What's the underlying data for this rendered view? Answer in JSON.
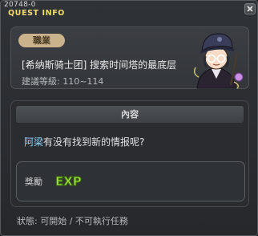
{
  "window": {
    "quest_id": "20748-0",
    "title": "QUEST INFO"
  },
  "job": {
    "tag": "職業",
    "name": "[希纳斯骑士团] 搜索时间塔的最底层",
    "level": "建議等級: 110~114"
  },
  "content": {
    "header": "內容",
    "npc_name": "阿梁",
    "text": "有没有找到新的情报呢?"
  },
  "reward": {
    "label": "獎勵",
    "exp_badge": "EXP"
  },
  "status": "狀態: 可開始 / 不可執行任務",
  "colors": {
    "title": "#f2dc6a",
    "npc_link": "#8fd8ff",
    "job_tag_bg": "#c9b28c",
    "exp_green": "#9be33a",
    "exp_yellow": "#f3e43a"
  },
  "icons": {
    "close": "close-icon",
    "npc": "npc-portrait",
    "exp": "exp-icon"
  }
}
